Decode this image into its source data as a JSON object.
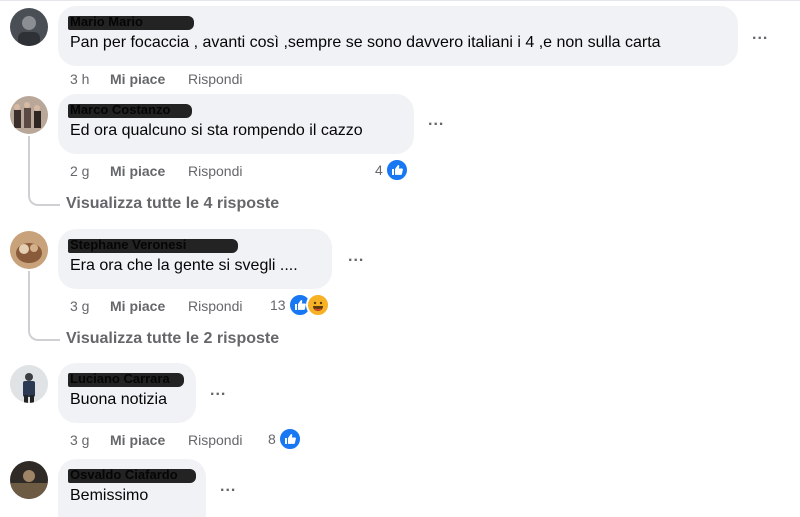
{
  "labels": {
    "like": "Mi piace",
    "reply": "Rispondi",
    "more": "..."
  },
  "comments": [
    {
      "author": "Mario Mario",
      "text": "Pan per focaccia , avanti così ,sempre se sono davvero italiani i 4 ,e non sulla carta",
      "time": "3 h"
    },
    {
      "author": "Marco Costanzo",
      "text": "Ed ora qualcuno si sta rompendo il cazzo",
      "time": "2 g",
      "reaction_count": "4",
      "view_replies": "Visualizza tutte le 4 risposte"
    },
    {
      "author": "Stephane Veronesi",
      "text": "Era ora che la gente si svegli ....",
      "time": "3 g",
      "reaction_count": "13",
      "view_replies": "Visualizza tutte le 2 risposte"
    },
    {
      "author": "Luciano Carrara",
      "text": "Buona notizia",
      "time": "3 g",
      "reaction_count": "8"
    },
    {
      "author": "Osvaldo Ciafardo",
      "text": "Bemissimo"
    }
  ],
  "icons": {
    "like": "thumbs-up-icon",
    "haha": "laughing-face-icon",
    "more": "more-options-icon"
  },
  "colors": {
    "like_blue": "#1877f2",
    "bubble": "#f0f2f5",
    "meta_gray": "#65676b"
  }
}
